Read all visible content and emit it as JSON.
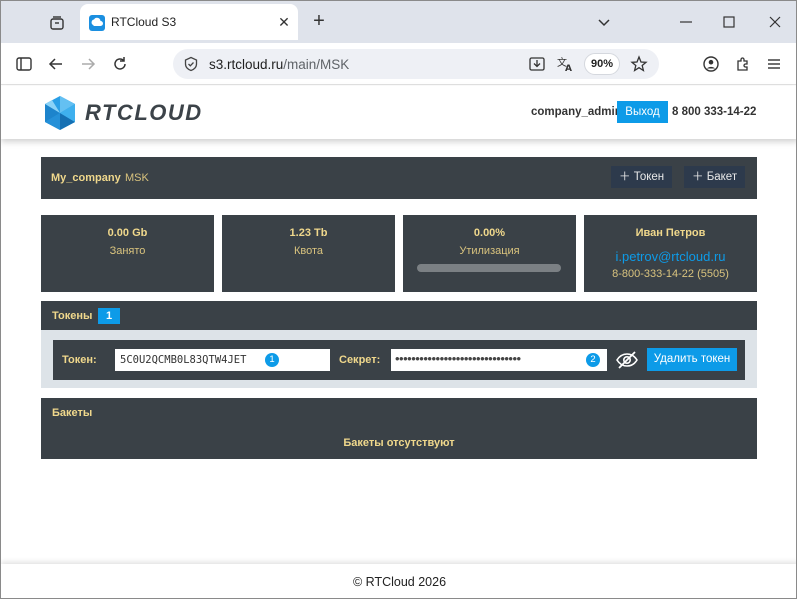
{
  "browser": {
    "tab_title": "RTCloud S3",
    "url_host": "s3.rtcloud.ru",
    "url_path": "/main/MSK",
    "zoom": "90%"
  },
  "header": {
    "logo_text": "RTCLOUD",
    "user": "company_admin",
    "logout_label": "Выход",
    "phone": "8 800 333-14-22"
  },
  "breadcrumb": {
    "company": "My_company",
    "region": "MSK",
    "add_token_label": "Токен",
    "add_bucket_label": "Бакет"
  },
  "stats": {
    "used_value": "0.00 Gb",
    "used_label": "Занято",
    "quota_value": "1.23 Tb",
    "quota_label": "Квота",
    "util_value": "0.00%",
    "util_label": "Утилизация",
    "util_fraction": 0.0
  },
  "contact": {
    "name": "Иван Петров",
    "email": "i.petrov@rtcloud.ru",
    "phone": "8-800-333-14-22 (5505)"
  },
  "tokens": {
    "title": "Токены",
    "count": "1",
    "token_label": "Токен:",
    "token_value": "5C0U2QCMB0L83QTW4JET",
    "token_badge": "1",
    "secret_label": "Секрет:",
    "secret_masked": "•••••••••••••••••••••••••••••••",
    "secret_badge": "2",
    "delete_label": "Удалить токен"
  },
  "buckets": {
    "title": "Бакеты",
    "empty_message": "Бакеты отсутствуют"
  },
  "footer": {
    "copyright": "© RTCloud 2026"
  },
  "colors": {
    "accent": "#0d9be8",
    "panel": "#3a4147",
    "label": "#f0d88c"
  }
}
